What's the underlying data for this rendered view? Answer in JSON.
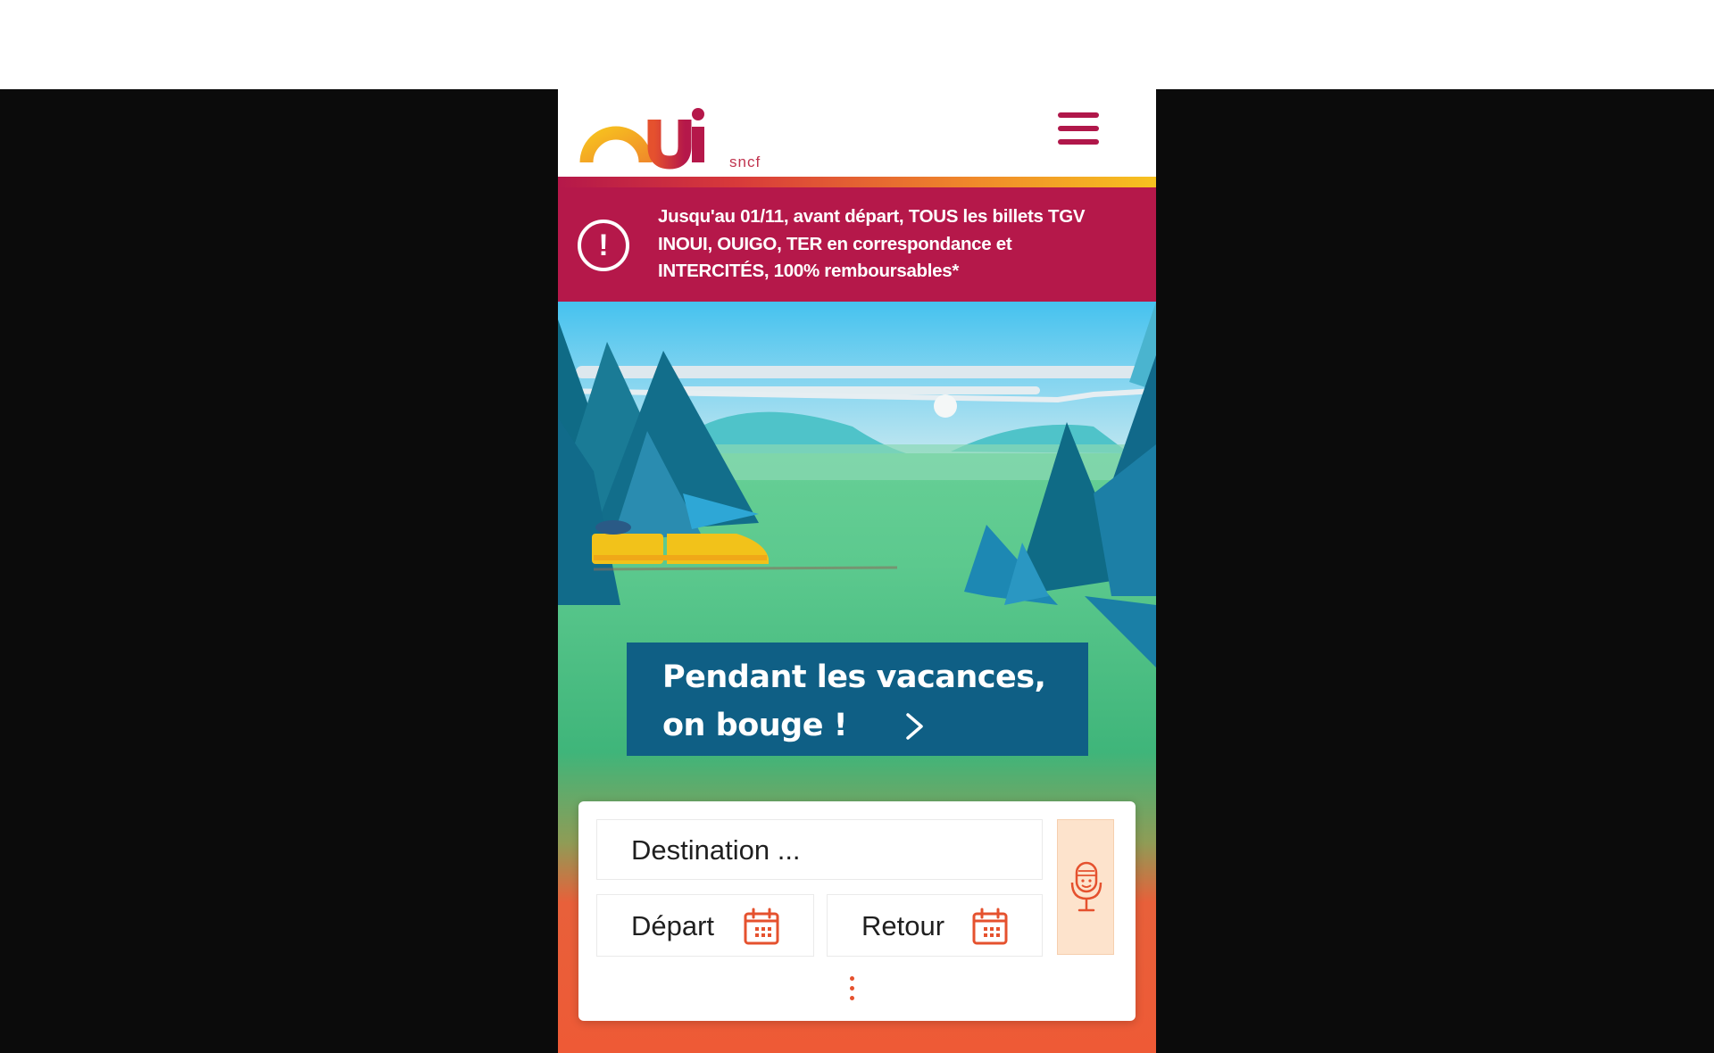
{
  "header": {
    "logo_alt": "OUI.sncf",
    "logo_suffix": "sncf",
    "menu_icon": "hamburger-menu-icon"
  },
  "alert": {
    "icon": "exclamation-circle-icon",
    "text": "Jusqu'au 01/11, avant départ, TOUS les billets TGV INOUI, OUIGO, TER en correspondance et INTERCITÉS, 100% remboursables*"
  },
  "promo": {
    "line1": "Pendant les vacances,",
    "line2": "on bouge !",
    "chevron_icon": "chevron-right-icon"
  },
  "search": {
    "destination_placeholder": "Destination ...",
    "depart_label": "Départ",
    "retour_label": "Retour",
    "calendar_icon": "calendar-icon",
    "mic_icon": "microphone-icon",
    "more_icon": "more-options-icon"
  },
  "colors": {
    "brand_crimson": "#b5184a",
    "promo_blue": "#0f5f85",
    "accent_orange": "#e5512e",
    "mic_bg": "#fde3cc"
  }
}
